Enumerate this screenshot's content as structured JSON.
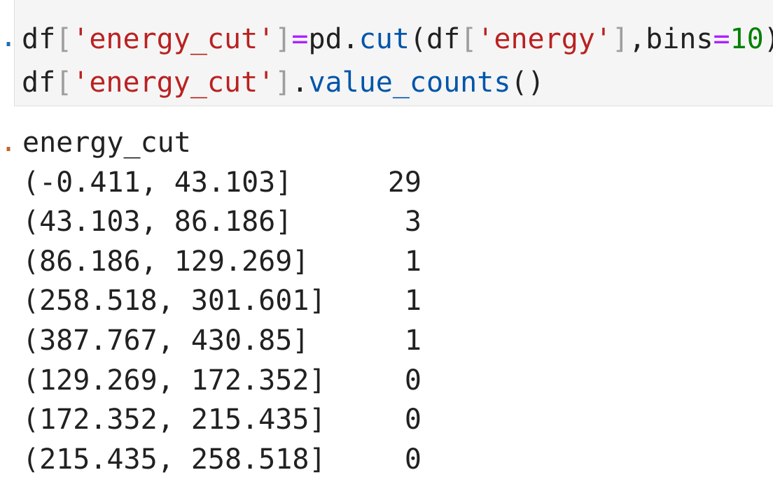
{
  "cell_input": {
    "marker": ".",
    "line1": [
      {
        "t": "df",
        "c": "plain"
      },
      {
        "t": "[",
        "c": "bracket"
      },
      {
        "t": "'energy_cut'",
        "c": "str"
      },
      {
        "t": "]",
        "c": "bracket"
      },
      {
        "t": "=",
        "c": "op"
      },
      {
        "t": "pd.",
        "c": "plain"
      },
      {
        "t": "cut",
        "c": "func"
      },
      {
        "t": "(df",
        "c": "plain"
      },
      {
        "t": "[",
        "c": "bracket"
      },
      {
        "t": "'energy'",
        "c": "str"
      },
      {
        "t": "]",
        "c": "bracket"
      },
      {
        "t": ",bins",
        "c": "plain"
      },
      {
        "t": "=",
        "c": "op"
      },
      {
        "t": "10",
        "c": "num"
      },
      {
        "t": ")",
        "c": "plain"
      }
    ],
    "line2": [
      {
        "t": "df",
        "c": "plain"
      },
      {
        "t": "[",
        "c": "bracket"
      },
      {
        "t": "'energy_cut'",
        "c": "str"
      },
      {
        "t": "]",
        "c": "bracket"
      },
      {
        "t": ".",
        "c": "plain"
      },
      {
        "t": "value_counts",
        "c": "func"
      },
      {
        "t": "()",
        "c": "plain"
      }
    ]
  },
  "cell_output": {
    "marker": ".",
    "series_name": "energy_cut",
    "rows": [
      {
        "label": "(-0.411, 43.103]",
        "count": "29"
      },
      {
        "label": "(43.103, 86.186]",
        "count": "3"
      },
      {
        "label": "(86.186, 129.269]",
        "count": "1"
      },
      {
        "label": "(258.518, 301.601]",
        "count": "1"
      },
      {
        "label": "(387.767, 430.85]",
        "count": "1"
      },
      {
        "label": "(129.269, 172.352]",
        "count": "0"
      },
      {
        "label": "(172.352, 215.435]",
        "count": "0"
      },
      {
        "label": "(215.435, 258.518]",
        "count": "0"
      }
    ]
  }
}
